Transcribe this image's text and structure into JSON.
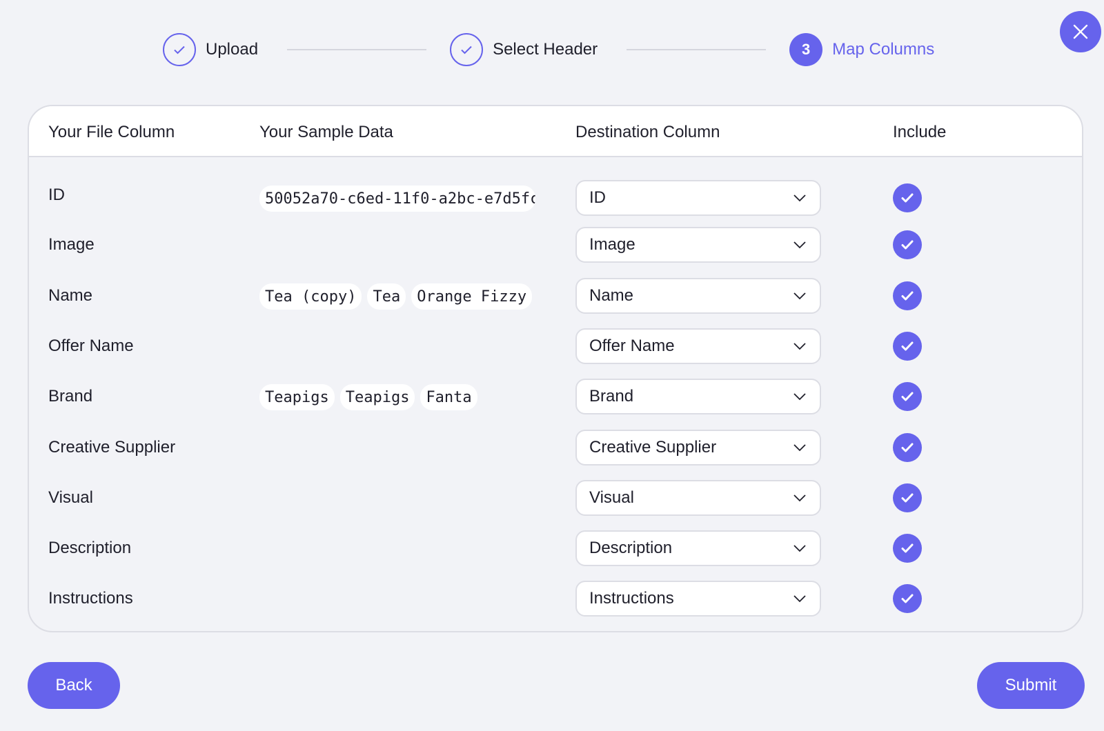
{
  "stepper": {
    "steps": [
      {
        "label": "Upload",
        "state": "done"
      },
      {
        "label": "Select Header",
        "state": "done"
      },
      {
        "label": "Map Columns",
        "state": "active",
        "number": "3"
      }
    ]
  },
  "table": {
    "headers": {
      "file_column": "Your File Column",
      "sample_data": "Your Sample Data",
      "destination": "Destination Column",
      "include": "Include"
    },
    "rows": [
      {
        "file_column": "ID",
        "samples": [
          "50052a70-c6ed-11f0-a2bc-e7d5fc"
        ],
        "destination": "ID",
        "include": true
      },
      {
        "file_column": "Image",
        "samples": [],
        "destination": "Image",
        "include": true
      },
      {
        "file_column": "Name",
        "samples": [
          "Tea (copy)",
          "Tea",
          "Orange Fizzy"
        ],
        "destination": "Name",
        "include": true
      },
      {
        "file_column": "Offer Name",
        "samples": [],
        "destination": "Offer Name",
        "include": true
      },
      {
        "file_column": "Brand",
        "samples": [
          "Teapigs",
          "Teapigs",
          "Fanta"
        ],
        "destination": "Brand",
        "include": true
      },
      {
        "file_column": "Creative Supplier",
        "samples": [],
        "destination": "Creative Supplier",
        "include": true
      },
      {
        "file_column": "Visual",
        "samples": [],
        "destination": "Visual",
        "include": true
      },
      {
        "file_column": "Description",
        "samples": [],
        "destination": "Description",
        "include": true
      },
      {
        "file_column": "Instructions",
        "samples": [],
        "destination": "Instructions",
        "include": true
      }
    ]
  },
  "footer": {
    "back_label": "Back",
    "submit_label": "Submit"
  },
  "colors": {
    "accent": "#6663ec",
    "background": "#f2f3f7"
  }
}
